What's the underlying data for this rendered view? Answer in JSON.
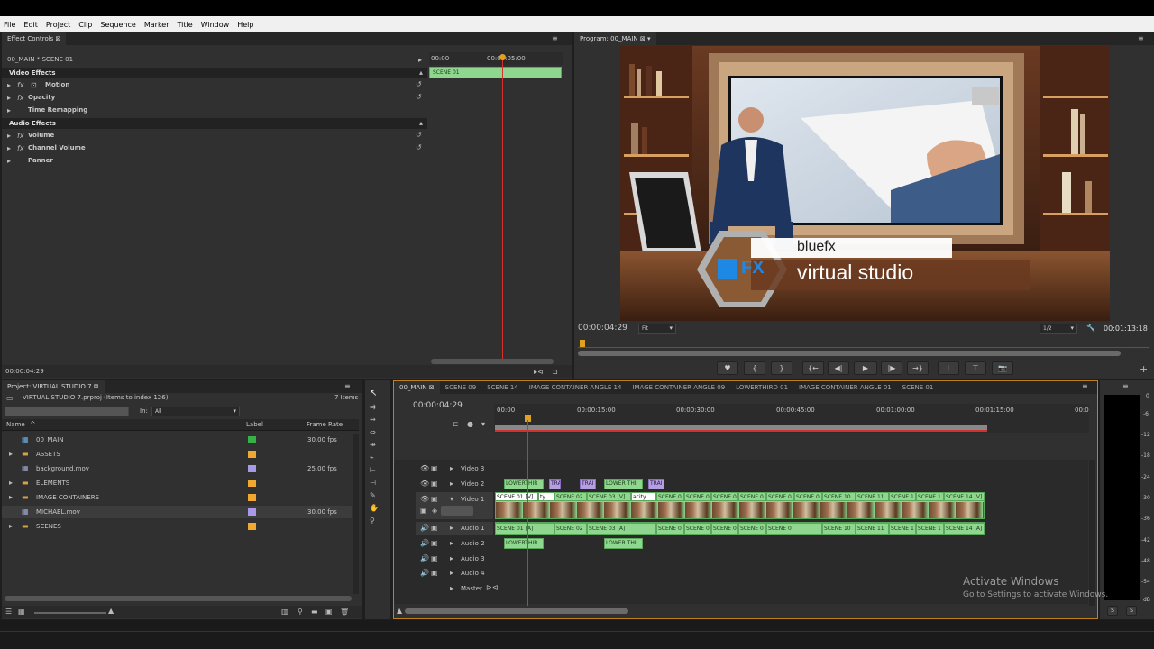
{
  "menu": [
    "File",
    "Edit",
    "Project",
    "Clip",
    "Sequence",
    "Marker",
    "Title",
    "Window",
    "Help"
  ],
  "effect_controls": {
    "tab": "Effect Controls",
    "clip_path": "00_MAIN * SCENE 01",
    "ruler_start": "00:00",
    "ruler_mark": "00:00:05:00",
    "clip_bar": "SCENE 01",
    "video_effects": "Video Effects",
    "items_video": [
      "Motion",
      "Opacity",
      "Time Remapping"
    ],
    "audio_effects": "Audio Effects",
    "items_audio": [
      "Volume",
      "Channel Volume",
      "Panner"
    ],
    "timecode": "00:00:04:29"
  },
  "program": {
    "tab": "Program: 00_MAIN",
    "timecode": "00:00:04:29",
    "fit": "Fit",
    "quality": "1/2",
    "duration": "00:01:13:18",
    "lower_third_title": "bluefx",
    "lower_third_sub": "virtual studio",
    "logo_text": "FX"
  },
  "project": {
    "tab": "Project: VIRTUAL STUDIO 7",
    "file": "VIRTUAL STUDIO 7.prproj (Items to index 126)",
    "count": "7 Items",
    "in_label": "In:",
    "in_value": "All",
    "col_name": "Name",
    "col_label": "Label",
    "col_fps": "Frame Rate",
    "rows": [
      {
        "name": "00_MAIN",
        "fps": "30.00 fps",
        "color": "#38b048"
      },
      {
        "name": "ASSETS",
        "fps": "",
        "color": "#f0a830"
      },
      {
        "name": "background.mov",
        "fps": "25.00 fps",
        "color": "#a898e8"
      },
      {
        "name": "ELEMENTS",
        "fps": "",
        "color": "#f0a830"
      },
      {
        "name": "IMAGE CONTAINERS",
        "fps": "",
        "color": "#f0a830"
      },
      {
        "name": "MICHAEL.mov",
        "fps": "30.00 fps",
        "color": "#a898e8"
      },
      {
        "name": "SCENES",
        "fps": "",
        "color": "#f0a830"
      }
    ]
  },
  "timeline": {
    "tabs": [
      "00_MAIN",
      "SCENE 09",
      "SCENE 14",
      "IMAGE CONTAINER ANGLE 14",
      "IMAGE CONTAINER ANGLE 09",
      "LOWERTHIRD 01",
      "IMAGE CONTAINER ANGLE 01",
      "SCENE 01"
    ],
    "timecode": "00:00:04:29",
    "ruler": [
      "00:00",
      "00:00:15:00",
      "00:00:30:00",
      "00:00:45:00",
      "00:01:00:00",
      "00:01:15:00",
      "00:0"
    ],
    "tracks": [
      "Video 3",
      "Video 2",
      "Video 1",
      "Audio 1",
      "Audio 2",
      "Audio 3",
      "Audio 4",
      "Master"
    ],
    "v2_clips": [
      "LOWERTHIR",
      "TRA",
      "TRAI",
      "LOWER THI",
      "TRAI"
    ],
    "v1_clips": [
      "SCENE 01 [V]",
      "ty",
      "SCENE 02",
      "SCENE 03 [V]",
      "acity",
      "SCENE 0",
      "SCENE 0",
      "SCENE 0",
      "SCENE 0",
      "SCENE 0",
      "SCENE 0",
      "SCENE 10",
      "SCENE 11",
      "SCENE 1",
      "SCENE 1",
      "SCENE 14 [V]"
    ],
    "a1_clips": [
      "SCENE 01 [A]",
      "SCENE 02",
      "SCENE 03 [A]",
      "SCENE 0",
      "SCENE 0",
      "SCENE 0",
      "SCENE 0",
      "SCENE 0",
      "SCENE 10",
      "SCENE 11",
      "SCENE 1",
      "SCENE 1",
      "SCENE 14 [A]"
    ],
    "a2_clips": [
      "LOWERTHIR",
      "LOWER THI"
    ]
  },
  "meter": {
    "scale": [
      "0",
      "-6",
      "-12",
      "-18",
      "-24",
      "-30",
      "-36",
      "-42",
      "-48",
      "-54",
      "dB"
    ],
    "solo": [
      "S",
      "S"
    ]
  },
  "watermark": {
    "title": "Activate Windows",
    "sub": "Go to Settings to activate Windows."
  }
}
